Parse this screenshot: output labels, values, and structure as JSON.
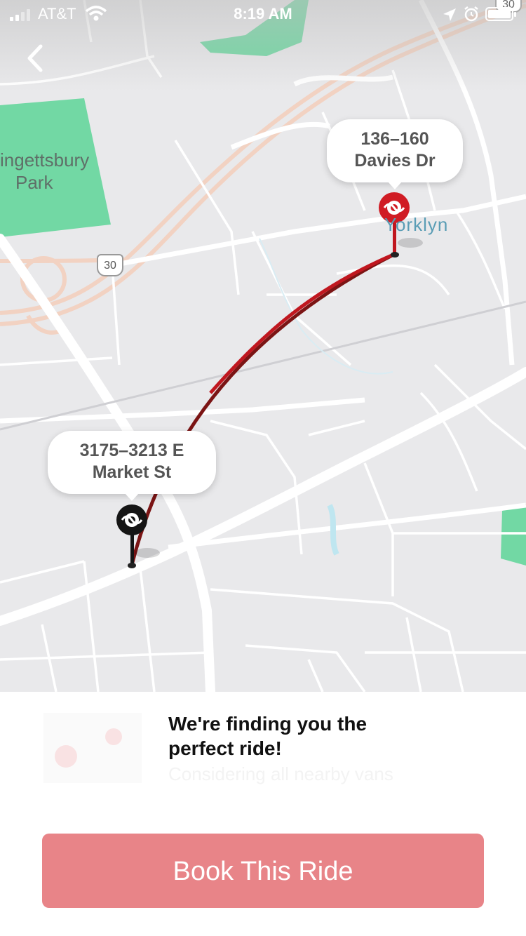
{
  "status_bar": {
    "carrier": "AT&T",
    "time": "8:19 AM"
  },
  "map": {
    "park_label": "ingettsbury\nPark",
    "town_label": "Yorklyn",
    "highway_shield": "30",
    "highway_shield_2": "30",
    "destination_label": "136–160\nDavies Dr",
    "origin_label": "3175–3213 E\nMarket St",
    "route_color": "#c0171f",
    "destination_pin_color": "#d01c24",
    "origin_pin_color": "#151515"
  },
  "panel": {
    "title": "We're finding you the perfect ride!",
    "subtitle": "Considering all nearby vans",
    "book_button": "Book This Ride",
    "button_color": "#e88488"
  }
}
